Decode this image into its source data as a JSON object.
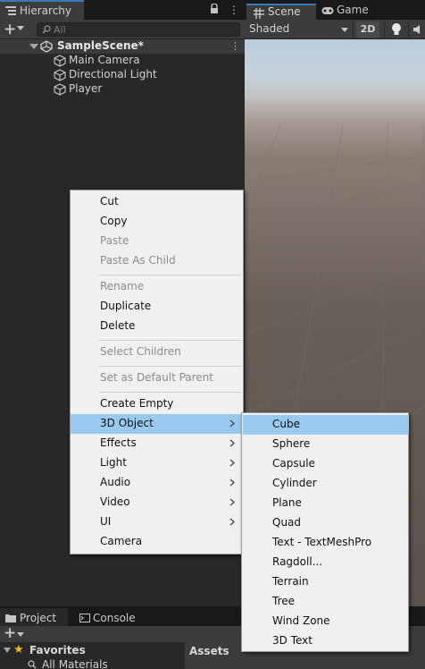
{
  "hierarchy": {
    "tab_label": "Hierarchy",
    "search_placeholder": "All",
    "scene_name": "SampleScene*",
    "objects": [
      "Main Camera",
      "Directional Light",
      "Player"
    ]
  },
  "scene_view": {
    "tab_scene": "Scene",
    "tab_game": "Game",
    "draw_mode": "Shaded",
    "mode_2d": "2D"
  },
  "context_menu": {
    "items": [
      {
        "label": "Cut",
        "enabled": true
      },
      {
        "label": "Copy",
        "enabled": true
      },
      {
        "label": "Paste",
        "enabled": false
      },
      {
        "label": "Paste As Child",
        "enabled": false
      },
      {
        "label": "Rename",
        "enabled": false
      },
      {
        "label": "Duplicate",
        "enabled": true
      },
      {
        "label": "Delete",
        "enabled": true
      },
      {
        "label": "Select Children",
        "enabled": false
      },
      {
        "label": "Set as Default Parent",
        "enabled": false
      },
      {
        "label": "Create Empty",
        "enabled": true
      },
      {
        "label": "3D Object",
        "enabled": true,
        "submenu": true,
        "highlighted": true
      },
      {
        "label": "Effects",
        "enabled": true,
        "submenu": true
      },
      {
        "label": "Light",
        "enabled": true,
        "submenu": true
      },
      {
        "label": "Audio",
        "enabled": true,
        "submenu": true
      },
      {
        "label": "Video",
        "enabled": true,
        "submenu": true
      },
      {
        "label": "UI",
        "enabled": true,
        "submenu": true
      },
      {
        "label": "Camera",
        "enabled": true
      }
    ],
    "highlight_color": "#99c9ef"
  },
  "submenu_3d_object": {
    "items": [
      {
        "label": "Cube",
        "highlighted": true
      },
      {
        "label": "Sphere"
      },
      {
        "label": "Capsule"
      },
      {
        "label": "Cylinder"
      },
      {
        "label": "Plane"
      },
      {
        "label": "Quad"
      },
      {
        "label": "Text - TextMeshPro"
      },
      {
        "label": "Ragdoll..."
      },
      {
        "label": "Terrain"
      },
      {
        "label": "Tree"
      },
      {
        "label": "Wind Zone"
      },
      {
        "label": "3D Text"
      }
    ]
  },
  "bottom": {
    "tab_project": "Project",
    "tab_console": "Console",
    "favorites": "Favorites",
    "all_materials": "All Materials",
    "assets": "Assets"
  },
  "colors": {
    "tab_accent": "#3a79bb",
    "favorites_star": "#f4b81b"
  }
}
